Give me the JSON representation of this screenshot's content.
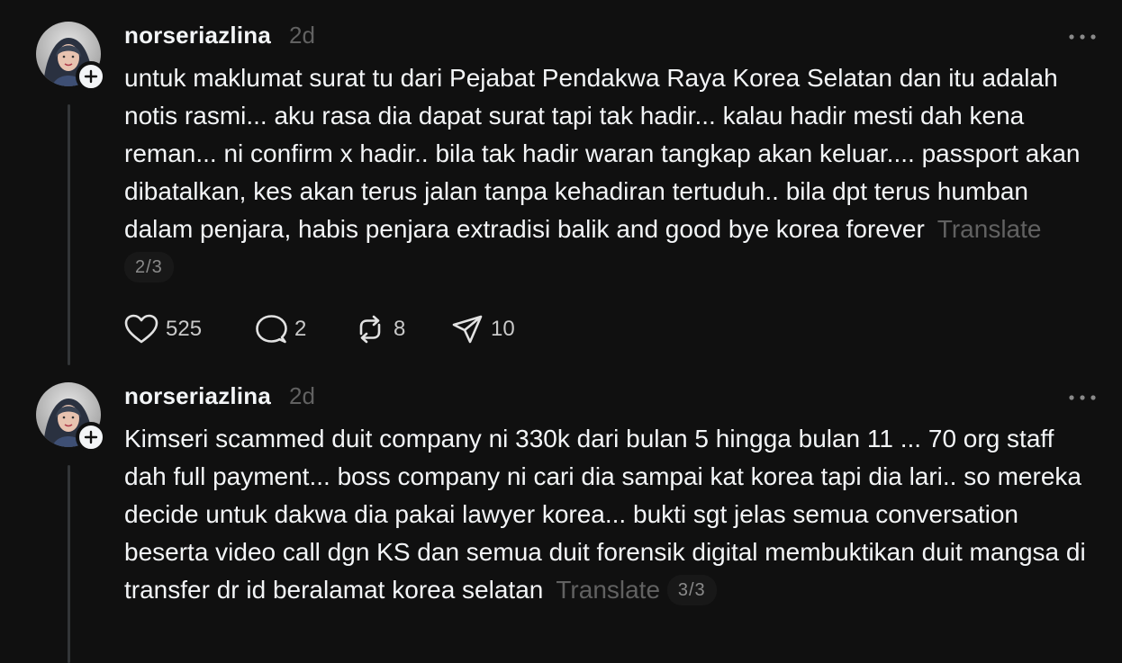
{
  "posts": [
    {
      "username": "norseriazlina",
      "time": "2d",
      "text": "untuk maklumat surat tu dari Pejabat Pendakwa Raya Korea Selatan dan itu adalah notis rasmi... aku rasa dia dapat surat tapi tak hadir... kalau hadir mesti dah kena reman... ni confirm x hadir.. bila tak hadir waran tangkap akan keluar.... passport akan dibatalkan, kes akan terus jalan tanpa kehadiran tertuduh.. bila dpt terus humban dalam penjara, habis penjara extradisi balik and good bye korea forever",
      "translate_label": "Translate",
      "counter": "2/3",
      "likes": "525",
      "replies": "2",
      "reposts": "8",
      "shares": "10"
    },
    {
      "username": "norseriazlina",
      "time": "2d",
      "text": "Kimseri scammed duit company ni 330k dari bulan 5 hingga bulan 11 ... 70 org staff dah full payment... boss company ni cari dia sampai kat korea tapi dia lari.. so mereka decide untuk dakwa dia pakai lawyer korea... bukti sgt jelas semua conversation beserta video call dgn KS dan semua duit forensik digital membuktikan duit mangsa di transfer dr id beralamat korea selatan",
      "translate_label": "Translate",
      "counter": "3/3"
    }
  ],
  "icons": {
    "like": "heart-icon",
    "reply": "comment-icon",
    "repost": "repost-icon",
    "share": "share-icon",
    "more": "more-icon",
    "follow": "plus-icon"
  },
  "colors": {
    "background": "#101010",
    "text": "#f3f5f7",
    "muted": "#616161"
  }
}
